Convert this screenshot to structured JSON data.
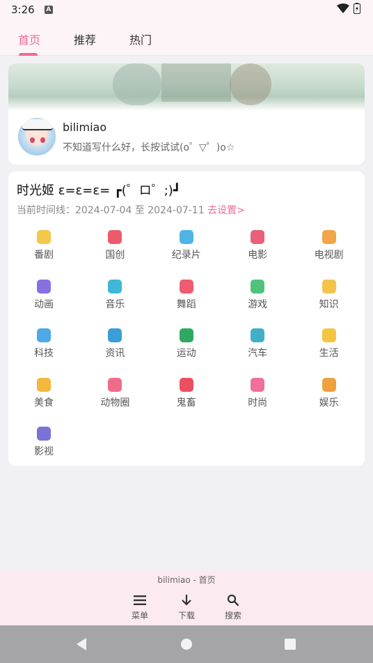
{
  "status_bar": {
    "time": "3:26",
    "badge": "A"
  },
  "tabs": [
    {
      "label": "首页",
      "active": true
    },
    {
      "label": "推荐",
      "active": false
    },
    {
      "label": "热门",
      "active": false
    }
  ],
  "profile": {
    "username": "bilimiao",
    "bio": "不知道写什么好，长按试试(o゜▽゜)o☆"
  },
  "timeline": {
    "title": "时光姬 ε=ε=ε= ┏(゜ロ゜;)┛",
    "range_text": "当前时间线：2024-07-04 至 2024-07-11",
    "set_link": "去设置>"
  },
  "categories": [
    {
      "label": "番剧",
      "icon": "tv-icon",
      "color": "#f5c84b"
    },
    {
      "label": "国创",
      "icon": "peach-icon",
      "color": "#ec5b6b"
    },
    {
      "label": "纪录片",
      "icon": "whale-icon",
      "color": "#4fb4e6"
    },
    {
      "label": "电影",
      "icon": "3d-glasses-icon",
      "color": "#e8607a"
    },
    {
      "label": "电视剧",
      "icon": "popcorn-icon",
      "color": "#f2a54a"
    },
    {
      "label": "动画",
      "icon": "play-icon",
      "color": "#8a6fe0"
    },
    {
      "label": "音乐",
      "icon": "headphones-icon",
      "color": "#3fb7d6"
    },
    {
      "label": "舞蹈",
      "icon": "fan-icon",
      "color": "#ef5b6f"
    },
    {
      "label": "游戏",
      "icon": "creeper-icon",
      "color": "#4fc37a"
    },
    {
      "label": "知识",
      "icon": "bulb-icon",
      "color": "#f3c34b"
    },
    {
      "label": "科技",
      "icon": "ufo-icon",
      "color": "#4da9e8"
    },
    {
      "label": "资讯",
      "icon": "news-icon",
      "color": "#3b9ed9"
    },
    {
      "label": "运动",
      "icon": "running-icon",
      "color": "#2fa860"
    },
    {
      "label": "汽车",
      "icon": "car-icon",
      "color": "#3fb0c8"
    },
    {
      "label": "生活",
      "icon": "duck-icon",
      "color": "#f2c640"
    },
    {
      "label": "美食",
      "icon": "food-icon",
      "color": "#f2b73c"
    },
    {
      "label": "动物圈",
      "icon": "paw-icon",
      "color": "#f06d8a"
    },
    {
      "label": "鬼畜",
      "icon": "lion-icon",
      "color": "#ec4f5f"
    },
    {
      "label": "时尚",
      "icon": "dress-icon",
      "color": "#f06f9c"
    },
    {
      "label": "娱乐",
      "icon": "magic-wand-icon",
      "color": "#f0a03c"
    },
    {
      "label": "影视",
      "icon": "clapper-icon",
      "color": "#7b72d8"
    }
  ],
  "bottom_bar": {
    "title": "bilimiao - 首页",
    "menu_label": "菜单",
    "download_label": "下载",
    "search_label": "搜索"
  }
}
